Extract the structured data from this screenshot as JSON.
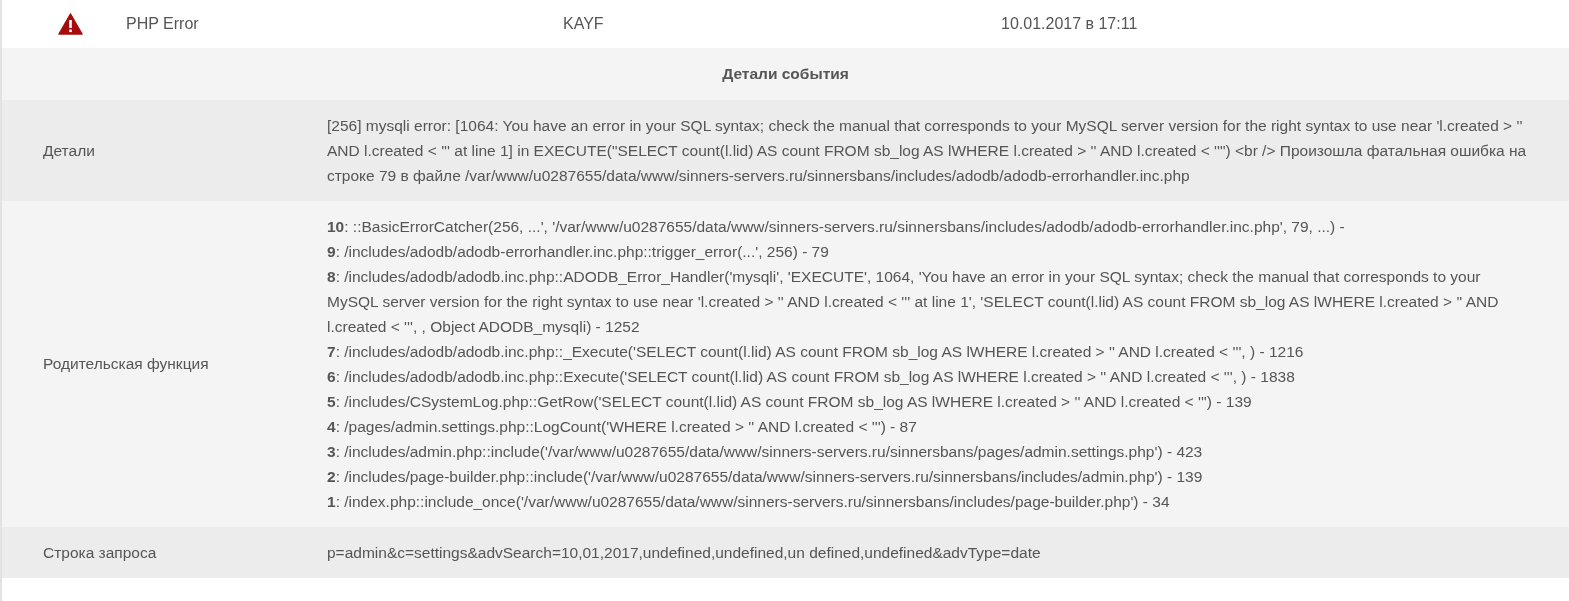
{
  "event": {
    "type": "PHP Error",
    "user": "KAYF",
    "date": "10.01.2017 в 17:11"
  },
  "section_title": "Детали события",
  "rows": [
    {
      "kind": "text",
      "label": "Детали",
      "value": "[256] mysqli error: [1064: You have an error in your SQL syntax; check the manual that corresponds to your MySQL server version for the right syntax to use near 'l.created > '' AND l.created < ''' at line 1] in EXECUTE(\"SELECT count(l.lid) AS count FROM sb_log AS lWHERE l.created > '' AND l.created < ''\") <br /> Произошла фатальная ошибка на строке 79 в файле /var/www/u0287655/data/www/sinners-servers.ru/sinnersbans/includes/adodb/adodb-errorhandler.inc.php"
    },
    {
      "kind": "trace",
      "label": "Родительская функция",
      "frames": [
        "**10**: ::BasicErrorCatcher(256, ...', '/var/www/u0287655/data/www/sinners-servers.ru/sinnersbans/includes/adodb/adodb-errorhandler.inc.php', 79, ...) -",
        "**9**: /includes/adodb/adodb-errorhandler.inc.php::trigger_error(...', 256) - 79",
        "**8**: /includes/adodb/adodb.inc.php::ADODB_Error_Handler('mysqli', 'EXECUTE', 1064, 'You have an error in your SQL syntax; check the manual that corresponds to your MySQL server version for the right syntax to use near 'l.created > '' AND l.created < ''' at line 1', 'SELECT count(l.lid) AS count FROM sb_log AS lWHERE l.created > '' AND l.created < ''', , Object ADODB_mysqli) - 1252",
        "**7**: /includes/adodb/adodb.inc.php::_Execute('SELECT count(l.lid) AS count FROM sb_log AS lWHERE l.created > '' AND l.created < ''', ) - 1216",
        "**6**: /includes/adodb/adodb.inc.php::Execute('SELECT count(l.lid) AS count FROM sb_log AS lWHERE l.created > '' AND l.created < ''', ) - 1838",
        "**5**: /includes/CSystemLog.php::GetRow('SELECT count(l.lid) AS count FROM sb_log AS lWHERE l.created > '' AND l.created < ''') - 139",
        "**4**: /pages/admin.settings.php::LogCount('WHERE l.created > '' AND l.created < ''') - 87",
        "**3**: /includes/admin.php::include('/var/www/u0287655/data/www/sinners-servers.ru/sinnersbans/pages/admin.settings.php') - 423",
        "**2**: /includes/page-builder.php::include('/var/www/u0287655/data/www/sinners-servers.ru/sinnersbans/includes/admin.php') - 139",
        "**1**: /index.php::include_once('/var/www/u0287655/data/www/sinners-servers.ru/sinnersbans/includes/page-builder.php') - 34"
      ]
    },
    {
      "kind": "text",
      "label": "Строка запроса",
      "value": "p=admin&c=settings&advSearch=10,01,2017,undefined,undefined,un defined,undefined&advType=date"
    }
  ]
}
